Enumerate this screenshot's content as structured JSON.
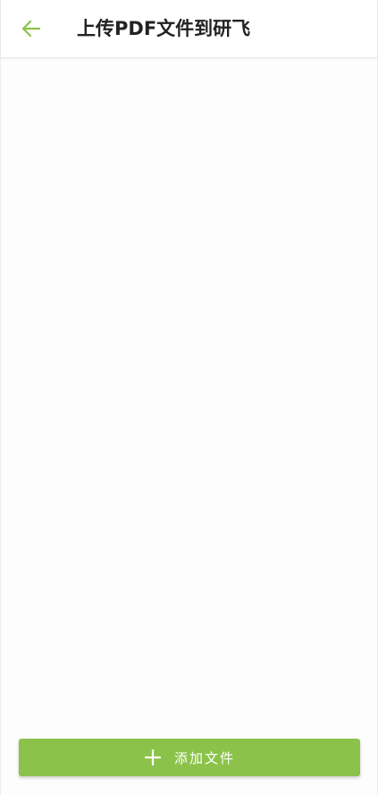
{
  "header": {
    "title": "上传PDF文件到研飞",
    "back_icon": "arrow-left-icon",
    "accent_color": "#8bc34a"
  },
  "footer": {
    "add_button_label": "添加文件",
    "add_icon": "plus-icon",
    "button_color": "#8bc34a"
  }
}
